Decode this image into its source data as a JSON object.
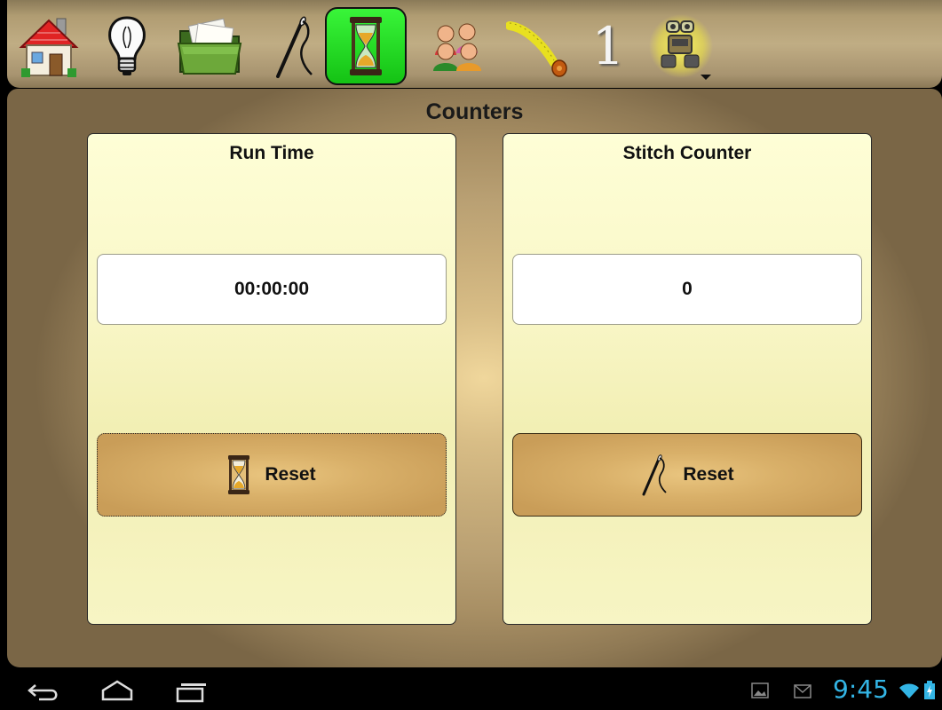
{
  "toolbar": {
    "items": [
      {
        "icon": "home-icon"
      },
      {
        "icon": "lightbulb-icon"
      },
      {
        "icon": "folder-icon"
      },
      {
        "icon": "needle-icon"
      },
      {
        "icon": "hourglass-icon",
        "active": true
      },
      {
        "icon": "people-icon"
      },
      {
        "icon": "measuring-tape-icon"
      },
      {
        "icon": "number-one-icon",
        "glyph": "1"
      },
      {
        "icon": "robot-icon",
        "has_dropdown": true
      }
    ],
    "active_color": "#22dd22"
  },
  "main": {
    "title": "Counters",
    "run_time": {
      "title": "Run Time",
      "value": "00:00:00",
      "reset_label": "Reset",
      "reset_icon": "hourglass-icon"
    },
    "stitch_counter": {
      "title": "Stitch Counter",
      "value": "0",
      "reset_label": "Reset",
      "reset_icon": "needle-icon"
    }
  },
  "system_bar": {
    "time": "9:45",
    "nav": [
      "back-icon",
      "home-icon",
      "recent-apps-icon"
    ],
    "notifications": [
      "gallery-icon",
      "gmail-icon"
    ],
    "status": [
      "wifi-icon",
      "battery-charging-icon"
    ],
    "accent": "#33b5e5"
  }
}
